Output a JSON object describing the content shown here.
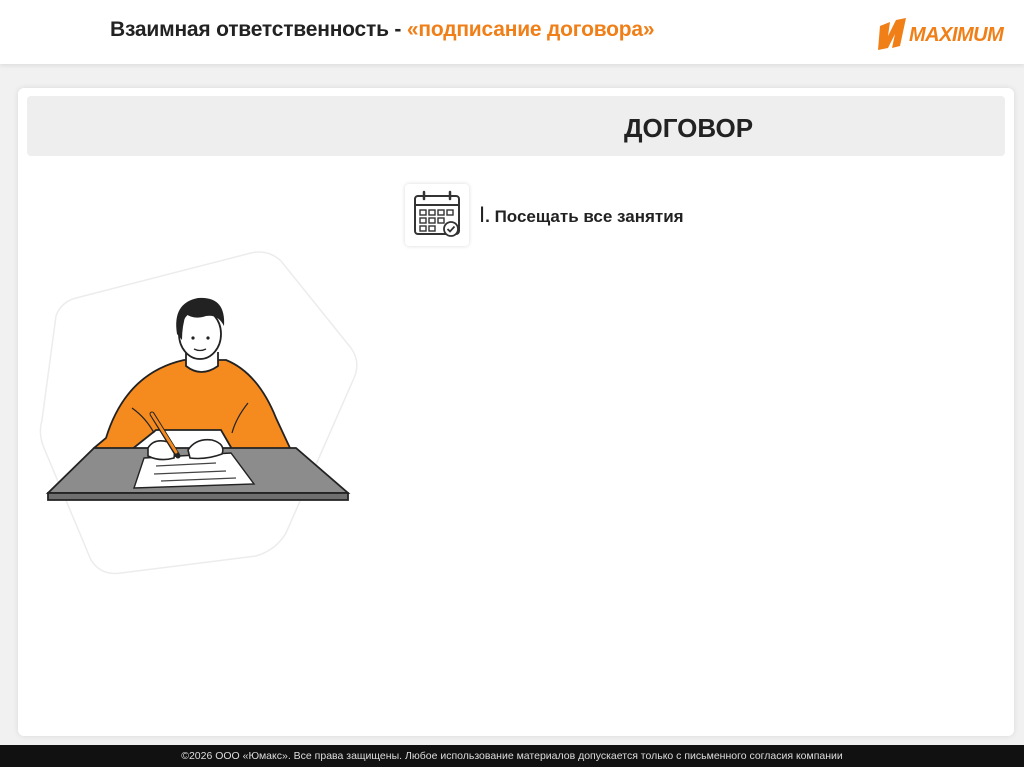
{
  "header": {
    "title_main": "Взаимная ответственность - ",
    "title_accent": "«подписание договора»",
    "logo_text": "MAXIMUM"
  },
  "banner": {
    "title": "ДОГОВОР"
  },
  "items": [
    {
      "number": "I",
      "text": ". Посещать все занятия",
      "icon": "calendar-check-icon"
    }
  ],
  "illustration": {
    "subject": "person-signing-contract"
  },
  "footer": {
    "text": "©2026 ООО «Юмакс». Все права защищены. Любое использование материалов допускается только с письменного согласия компании"
  },
  "colors": {
    "accent": "#f07f18",
    "banner_bg": "#eeeeee",
    "footer_bg": "#111111"
  }
}
